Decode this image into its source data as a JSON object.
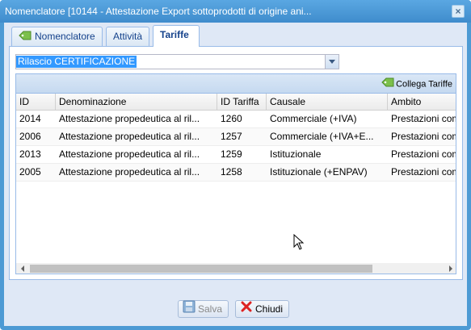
{
  "window": {
    "title": "Nomenclatore [10144 - Attestazione Export sottoprodotti di origine ani...",
    "close_icon": "close-icon"
  },
  "tabs": [
    {
      "label": "Nomenclatore",
      "icon": "tag-icon",
      "active": false
    },
    {
      "label": "Attività",
      "active": false
    },
    {
      "label": "Tariffe",
      "active": true
    }
  ],
  "combo": {
    "value": "Rilascio CERTIFICAZIONE"
  },
  "toolbar": {
    "collega_label": "Collega Tariffe",
    "collega_icon": "link-tag-icon"
  },
  "grid": {
    "columns": [
      "ID",
      "Denominazione",
      "ID Tariffa",
      "Causale",
      "Ambito"
    ],
    "rows": [
      {
        "id": "2014",
        "denominazione": "Attestazione propedeutica al ril...",
        "id_tariffa": "1260",
        "causale": "Commerciale (+IVA)",
        "ambito": "Prestazioni com"
      },
      {
        "id": "2006",
        "denominazione": "Attestazione propedeutica al ril...",
        "id_tariffa": "1257",
        "causale": "Commerciale (+IVA+E...",
        "ambito": "Prestazioni com"
      },
      {
        "id": "2013",
        "denominazione": "Attestazione propedeutica al ril...",
        "id_tariffa": "1259",
        "causale": "Istituzionale",
        "ambito": "Prestazioni com"
      },
      {
        "id": "2005",
        "denominazione": "Attestazione propedeutica al ril...",
        "id_tariffa": "1258",
        "causale": "Istituzionale (+ENPAV)",
        "ambito": "Prestazioni com"
      }
    ]
  },
  "footer": {
    "save_label": "Salva",
    "close_label": "Chiudi"
  },
  "colors": {
    "accent": "#4d9ad4",
    "selection": "#3399ff",
    "tab_text": "#15428b"
  }
}
